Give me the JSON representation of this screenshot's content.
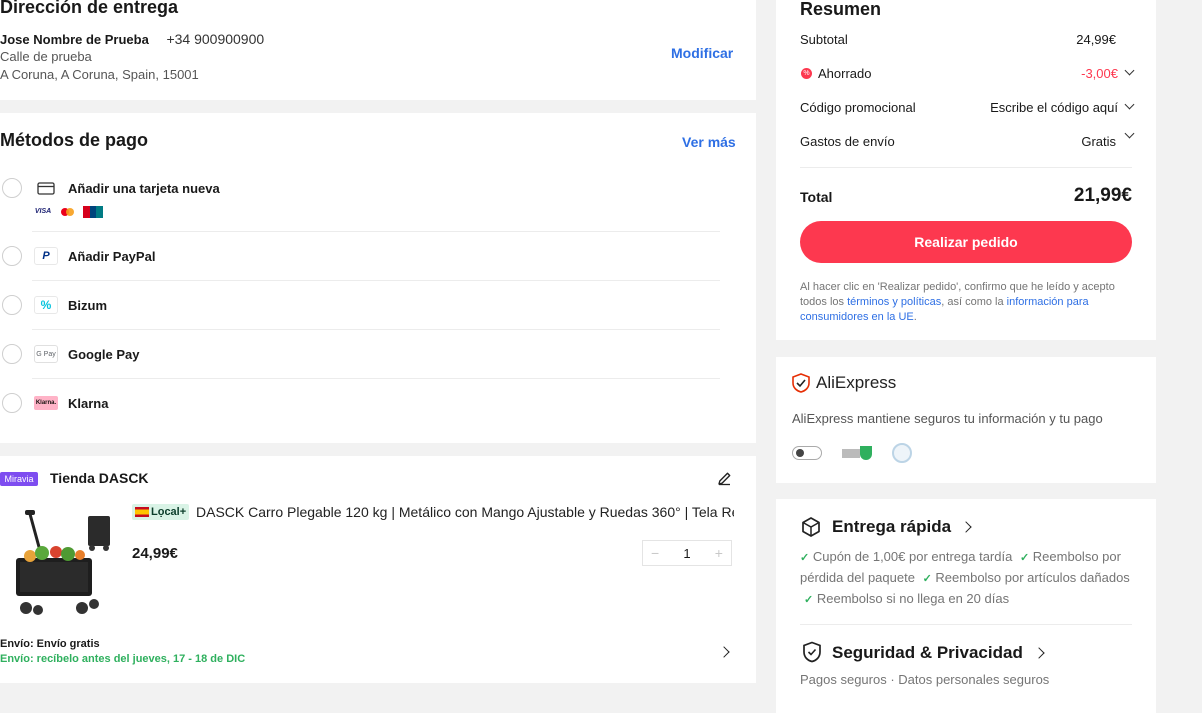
{
  "address": {
    "title": "Dirección de entrega",
    "name": "Jose Nombre de Prueba",
    "phone": "+34 900900900",
    "line1": "Calle de prueba",
    "line2": "A Coruna, A Coruna, Spain, 15001",
    "modify_label": "Modificar"
  },
  "payment": {
    "title": "Métodos de pago",
    "more_label": "Ver más",
    "methods": [
      {
        "label": "Añadir una tarjeta nueva",
        "icon": "card-icon"
      },
      {
        "label": "Añadir PayPal",
        "icon": "paypal-icon"
      },
      {
        "label": "Bizum",
        "icon": "bizum-icon"
      },
      {
        "label": "Google Pay",
        "icon": "googlepay-icon"
      },
      {
        "label": "Klarna",
        "icon": "klarna-icon"
      }
    ],
    "card_brands": [
      "VISA",
      "mastercard",
      "UnionPay"
    ],
    "gpay_text": "G Pay",
    "klarna_text": "Klarna."
  },
  "store": {
    "badge": "Miravia",
    "name": "Tienda DASCK",
    "product": {
      "local_badge": "Lọcal+",
      "title": "DASCK Carro Plegable 120 kg | Metálico con Mango Ajustable y Ruedas 360° | Tela Re",
      "price": "24,99€",
      "quantity": "1",
      "minus": "−",
      "plus": "+"
    },
    "shipping_label": "Envío: Envío gratis",
    "delivery_label": "Envío: recíbelo antes del jueves, 17 - 18 de DIC"
  },
  "summary": {
    "title": "Resumen",
    "subtotal_label": "Subtotal",
    "subtotal_value": "24,99€",
    "saved_label": "Ahorrado",
    "saved_value": "-3,00€",
    "promo_label": "Código promocional",
    "promo_value": "Escribe el código aquí",
    "shipping_label": "Gastos de envío",
    "shipping_value": "Gratis",
    "total_label": "Total",
    "total_value": "21,99€",
    "order_button": "Realizar pedido",
    "legal_1": "Al hacer clic en 'Realizar pedido', confirmo que he leído y acepto todos los ",
    "legal_link1": "términos y políticas",
    "legal_2": ", así como la ",
    "legal_link2": "información para consumidores en la UE",
    "legal_3": "."
  },
  "trust": {
    "brand": "AliExpress",
    "text": "AliExpress mantiene seguros tu información y tu pago"
  },
  "delivery": {
    "fast_title": "Entrega rápida",
    "benefits": [
      "Cupón de 1,00€ por entrega tardía",
      "Reembolso por pérdida del paquete",
      "Reembolso por artículos dañados",
      "Reembolso si no llega en 20 días"
    ],
    "security_title": "Seguridad & Privacidad",
    "security_text": "Pagos seguros · Datos personales seguros"
  },
  "colors": {
    "accent_red": "#fd384f",
    "link_blue": "#2e6fe4",
    "green": "#2fb05e",
    "saved_red": "#fd384f"
  }
}
